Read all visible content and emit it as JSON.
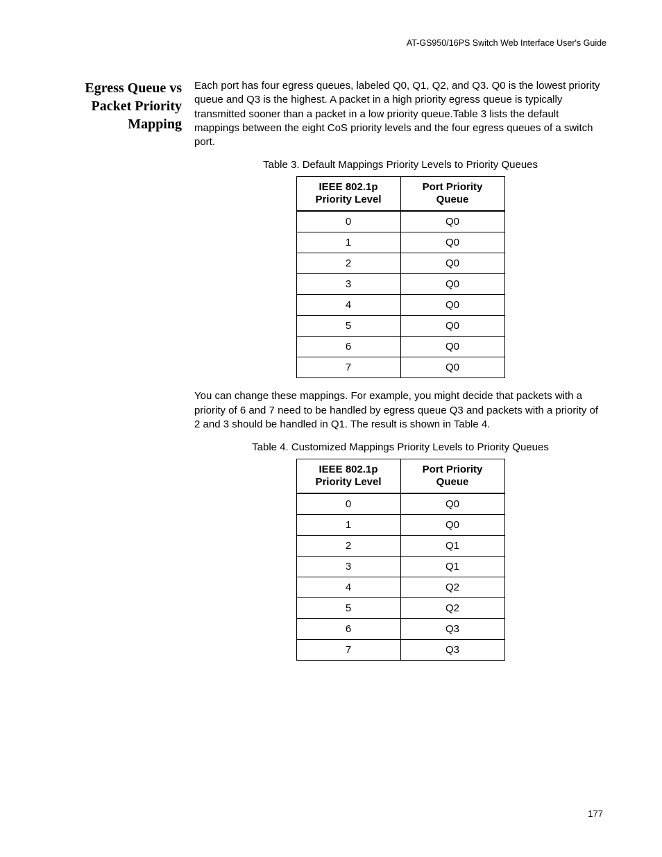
{
  "header": "AT-GS950/16PS Switch Web Interface User's Guide",
  "section_title_l1": "Egress Queue vs",
  "section_title_l2": "Packet Priority",
  "section_title_l3": "Mapping",
  "para1": "Each port has four egress queues, labeled Q0, Q1, Q2, and Q3. Q0 is the lowest priority queue and Q3 is the highest. A packet in a high priority egress queue is typically transmitted sooner than a packet in a low priority queue.Table 3 lists the default mappings between the eight CoS priority levels and the four egress queues of a switch port.",
  "table3_caption": "Table 3.  Default Mappings Priority Levels to Priority Queues",
  "col1_header_l1": "IEEE 802.1p",
  "col1_header_l2": "Priority Level",
  "col2_header_l1": "Port Priority",
  "col2_header_l2": "Queue",
  "table3_rows": [
    {
      "level": "0",
      "queue": "Q0"
    },
    {
      "level": "1",
      "queue": "Q0"
    },
    {
      "level": "2",
      "queue": "Q0"
    },
    {
      "level": "3",
      "queue": "Q0"
    },
    {
      "level": "4",
      "queue": "Q0"
    },
    {
      "level": "5",
      "queue": "Q0"
    },
    {
      "level": "6",
      "queue": "Q0"
    },
    {
      "level": "7",
      "queue": "Q0"
    }
  ],
  "para2": "You can change these mappings. For example, you might decide that packets with a priority of 6 and 7 need to be handled by egress queue Q3 and packets with a priority of 2 and 3 should be handled in Q1. The result is shown in Table 4.",
  "table4_caption": "Table 4. Customized Mappings Priority Levels to Priority Queues",
  "table4_rows": [
    {
      "level": "0",
      "queue": "Q0"
    },
    {
      "level": "1",
      "queue": "Q0"
    },
    {
      "level": "2",
      "queue": "Q1"
    },
    {
      "level": "3",
      "queue": "Q1"
    },
    {
      "level": "4",
      "queue": "Q2"
    },
    {
      "level": "5",
      "queue": "Q2"
    },
    {
      "level": "6",
      "queue": "Q3"
    },
    {
      "level": "7",
      "queue": "Q3"
    }
  ],
  "page_number": "177"
}
